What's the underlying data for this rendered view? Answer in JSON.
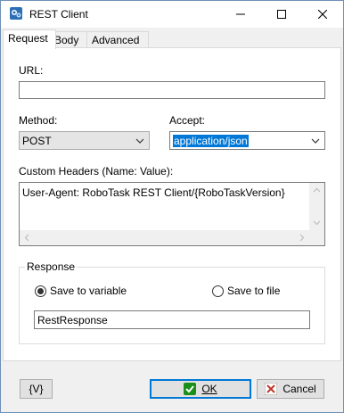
{
  "window": {
    "title": "REST Client"
  },
  "tabs": [
    {
      "label": "Request",
      "active": true
    },
    {
      "label": "Body",
      "active": false
    },
    {
      "label": "Advanced",
      "active": false
    }
  ],
  "request": {
    "url_label": "URL:",
    "url_value": "",
    "method_label": "Method:",
    "method_value": "POST",
    "accept_label": "Accept:",
    "accept_value": "application/json",
    "headers_label": "Custom Headers (Name: Value):",
    "headers_value": "User-Agent: RoboTask REST Client/{RoboTaskVersion}"
  },
  "response": {
    "group_title": "Response",
    "save_to_variable_label": "Save to variable",
    "save_to_file_label": "Save to file",
    "selected": "Save to variable",
    "variable_value": "RestResponse"
  },
  "footer": {
    "variables_button": "{V}",
    "ok_label": "OK",
    "cancel_label": "Cancel"
  },
  "colors": {
    "accent": "#0078d7",
    "ok_check": "#1a8f1a",
    "cancel_x": "#c0392b"
  },
  "icons": {
    "app": "rest-client-icon",
    "ok": "check-icon",
    "cancel": "x-icon"
  }
}
